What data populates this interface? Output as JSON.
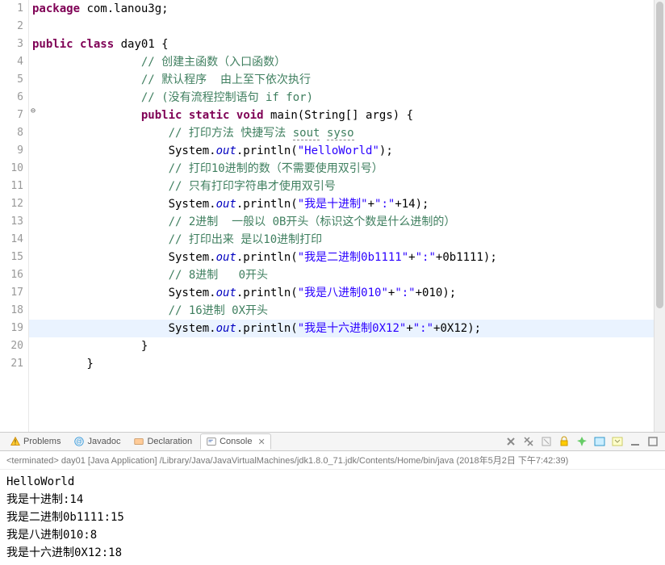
{
  "gutter": {
    "lines": [
      "1",
      "2",
      "3",
      "4",
      "5",
      "6",
      "7",
      "8",
      "9",
      "10",
      "11",
      "12",
      "13",
      "14",
      "15",
      "16",
      "17",
      "18",
      "19",
      "20",
      "21"
    ]
  },
  "code": {
    "l1": {
      "a": "package",
      "b": " com.lanou3g;"
    },
    "l3": {
      "a": "public",
      "b": " ",
      "c": "class",
      "d": " day01 {"
    },
    "l4": {
      "a": "                ",
      "b": "// 创建主函数（入口函数）"
    },
    "l5": {
      "a": "                ",
      "b": "// 默认程序  由上至下依次执行"
    },
    "l6": {
      "a": "                ",
      "b": "// (没有流程控制语句 if for)"
    },
    "l7": {
      "a": "                ",
      "b": "public",
      "c": " ",
      "d": "static",
      "e": " ",
      "f": "void",
      "g": " main(String[] args) {"
    },
    "l8": {
      "a": "                    ",
      "b": "// 打印方法 快捷写法 ",
      "c": "sout",
      "d": " ",
      "e": "syso"
    },
    "l9": {
      "a": "                    System.",
      "b": "out",
      "c": ".println(",
      "d": "\"HelloWorld\"",
      "e": ");"
    },
    "l10": {
      "a": "                    ",
      "b": "// 打印10进制的数（不需要使用双引号）"
    },
    "l11": {
      "a": "                    ",
      "b": "// 只有打印字符串才使用双引号"
    },
    "l12": {
      "a": "                    System.",
      "b": "out",
      "c": ".println(",
      "d": "\"我是十进制\"",
      "e": "+",
      "f": "\":\"",
      "g": "+14);"
    },
    "l13": {
      "a": "                    ",
      "b": "// 2进制  一般以 0B开头（标识这个数是什么进制的）"
    },
    "l14": {
      "a": "                    ",
      "b": "// 打印出来 是以10进制打印"
    },
    "l15": {
      "a": "                    System.",
      "b": "out",
      "c": ".println(",
      "d": "\"我是二进制0b1111\"",
      "e": "+",
      "f": "\":\"",
      "g": "+0b1111);"
    },
    "l16": {
      "a": "                    ",
      "b": "// 8进制   0开头"
    },
    "l17": {
      "a": "                    System.",
      "b": "out",
      "c": ".println(",
      "d": "\"我是八进制010\"",
      "e": "+",
      "f": "\":\"",
      "g": "+010);"
    },
    "l18": {
      "a": "                    ",
      "b": "// 16进制 0X开头"
    },
    "l19": {
      "a": "                    System.",
      "b": "out",
      "c": ".println(",
      "d": "\"我是十六进制0X12\"",
      "e": "+",
      "f": "\":\"",
      "g": "+0X12);"
    },
    "l20": "                }",
    "l21": "        }"
  },
  "panel": {
    "problems_label": "Problems",
    "javadoc_label": "Javadoc",
    "declaration_label": "Declaration",
    "console_label": "Console",
    "status": "<terminated> day01 [Java Application] /Library/Java/JavaVirtualMachines/jdk1.8.0_71.jdk/Contents/Home/bin/java (2018年5月2日 下午7:42:39)"
  },
  "console": {
    "l1": "HelloWorld",
    "l2": "我是十进制:14",
    "l3": "我是二进制0b1111:15",
    "l4": "我是八进制010:8",
    "l5": "我是十六进制0X12:18"
  }
}
